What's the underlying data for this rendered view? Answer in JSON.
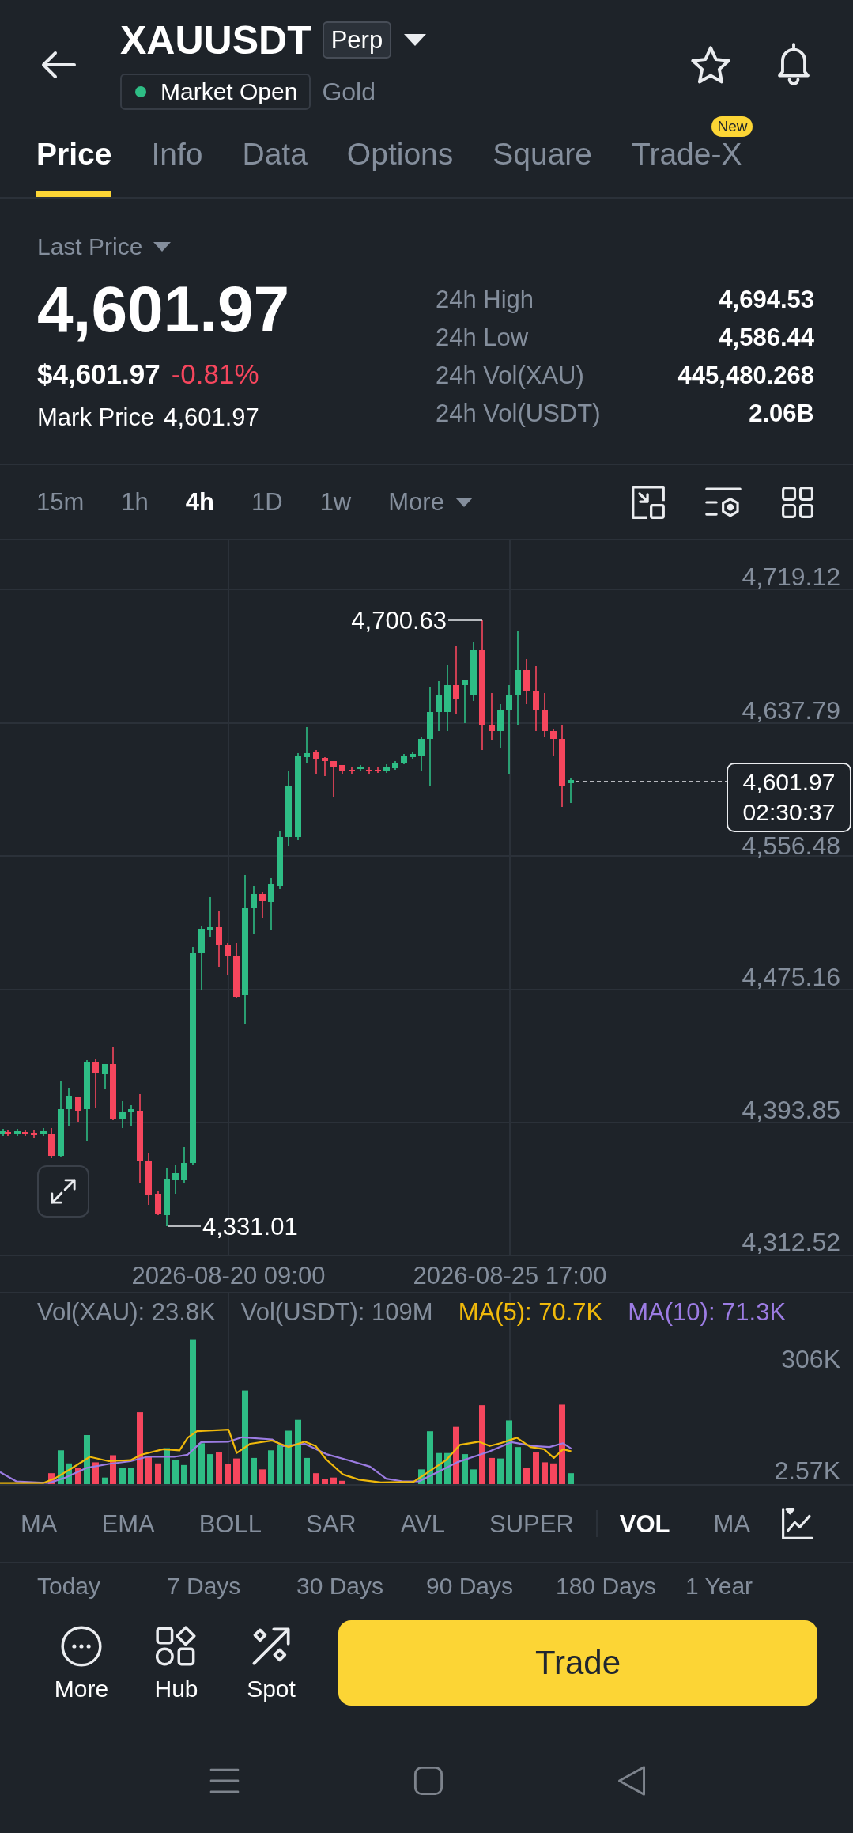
{
  "header": {
    "symbol": "XAUUSDT",
    "contract_badge": "Perp",
    "status": {
      "label": "Market Open",
      "open": true
    },
    "asset_name": "Gold"
  },
  "tabs": [
    {
      "label": "Price",
      "selected": true
    },
    {
      "label": "Info",
      "selected": false
    },
    {
      "label": "Data",
      "selected": false
    },
    {
      "label": "Options",
      "selected": false
    },
    {
      "label": "Square",
      "selected": false
    },
    {
      "label": "Trade-X",
      "selected": false,
      "badge": "New"
    }
  ],
  "price": {
    "selector": "Last Price",
    "last": "4,601.97",
    "usd": "$4,601.97",
    "change": "-0.81%",
    "change_negative": true,
    "mark_label": "Mark Price",
    "mark_value": "4,601.97"
  },
  "stats": [
    {
      "label": "24h High",
      "value": "4,694.53"
    },
    {
      "label": "24h Low",
      "value": "4,586.44"
    },
    {
      "label": "24h Vol(XAU)",
      "value": "445,480.268"
    },
    {
      "label": "24h Vol(USDT)",
      "value": "2.06B"
    }
  ],
  "intervals": [
    {
      "label": "15m",
      "selected": false,
      "kind": "interval"
    },
    {
      "label": "1h",
      "selected": false,
      "kind": "interval"
    },
    {
      "label": "4h",
      "selected": true,
      "kind": "interval"
    },
    {
      "label": "1D",
      "selected": false,
      "kind": "interval"
    },
    {
      "label": "1w",
      "selected": false,
      "kind": "interval"
    },
    {
      "label": "More",
      "selected": false,
      "kind": "dropdown"
    }
  ],
  "chart": {
    "price_axis": [
      "4,719.12",
      "4,637.79",
      "4,556.48",
      "4,475.16",
      "4,393.85",
      "4,312.52"
    ],
    "high_label": "4,700.63",
    "low_label": "4,331.01",
    "current_price": "4,601.97",
    "countdown": "02:30:37",
    "time_axis": [
      "2026-08-20 09:00",
      "2026-08-25 17:00"
    ]
  },
  "volume": {
    "legend": [
      {
        "text": "Vol(XAU): 23.8K",
        "color": "#848e9c"
      },
      {
        "text": "Vol(USDT): 109M",
        "color": "#848e9c"
      },
      {
        "text": "MA(5): 70.7K",
        "color": "#f0b90b"
      },
      {
        "text": "MA(10): 71.3K",
        "color": "#9c7ce3"
      }
    ],
    "axis": [
      "306K",
      "2.57K"
    ]
  },
  "indicators": {
    "main": [
      {
        "label": "MA",
        "selected": false
      },
      {
        "label": "EMA",
        "selected": false
      },
      {
        "label": "BOLL",
        "selected": false
      },
      {
        "label": "SAR",
        "selected": false
      },
      {
        "label": "AVL",
        "selected": false
      },
      {
        "label": "SUPER",
        "selected": false
      }
    ],
    "sub": [
      {
        "label": "VOL",
        "selected": true
      },
      {
        "label": "MA",
        "selected": false
      }
    ]
  },
  "periods": [
    "Today",
    "7 Days",
    "30 Days",
    "90 Days",
    "180 Days",
    "1 Year"
  ],
  "actions": [
    {
      "label": "More",
      "kind": "more"
    },
    {
      "label": "Hub",
      "kind": "hub"
    },
    {
      "label": "Spot",
      "kind": "spot"
    }
  ],
  "trade_button": "Trade"
}
